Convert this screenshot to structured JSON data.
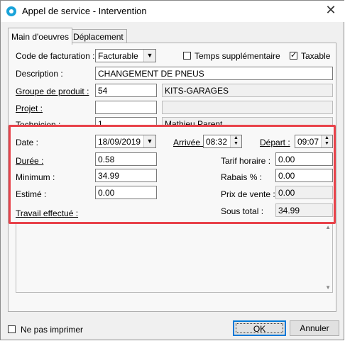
{
  "window": {
    "title": "Appel de service - Intervention",
    "close_glyph": "✕"
  },
  "tabs": [
    {
      "label": "Main d'oeuvres",
      "active": true
    },
    {
      "label": "Déplacement",
      "active": false
    }
  ],
  "form": {
    "code_facturation": {
      "label": "Code de facturation :",
      "value": "Facturable"
    },
    "temps_supp": {
      "label": "Temps supplémentaire",
      "checked": false
    },
    "taxable": {
      "label": "Taxable",
      "checked": true
    },
    "description": {
      "label": "Description :",
      "value": "CHANGEMENT DE PNEUS"
    },
    "groupe_produit": {
      "label": "Groupe de produit :",
      "code": "54",
      "name": "KITS-GARAGES"
    },
    "projet": {
      "label": "Projet :",
      "code": "",
      "name": ""
    },
    "technicien": {
      "label": "Technicien :",
      "code": "1",
      "name": "Mathieu Parent"
    },
    "date": {
      "label": "Date :",
      "value": "18/09/2019"
    },
    "arrivee": {
      "label": "Arrivée :",
      "value": "08:32"
    },
    "depart": {
      "label": "Départ :",
      "value": "09:07"
    },
    "duree": {
      "label": "Durée :",
      "value": "0.58"
    },
    "tarif_horaire": {
      "label": "Tarif horaire :",
      "value": "0.00"
    },
    "minimum": {
      "label": "Minimum :",
      "value": "34.99"
    },
    "rabais": {
      "label": "Rabais % :",
      "value": "0.00"
    },
    "estime": {
      "label": "Estimé :",
      "value": "0.00"
    },
    "prix_vente": {
      "label": "Prix de vente :",
      "value": "0.00"
    },
    "travail_effectue": {
      "label": "Travail effectué :"
    },
    "sous_total": {
      "label": "Sous total :",
      "value": "34.99"
    }
  },
  "footer": {
    "ne_pas_imprimer": {
      "label": "Ne pas imprimer",
      "checked": false
    },
    "ok_label": "OK",
    "annuler_label": "Annuler"
  },
  "colors": {
    "highlight": "#e8424a",
    "focus_border": "#0078d7"
  },
  "icons": {
    "combo_arrow": "▼",
    "spin_up": "▲",
    "spin_down": "▼",
    "check": "✓"
  }
}
